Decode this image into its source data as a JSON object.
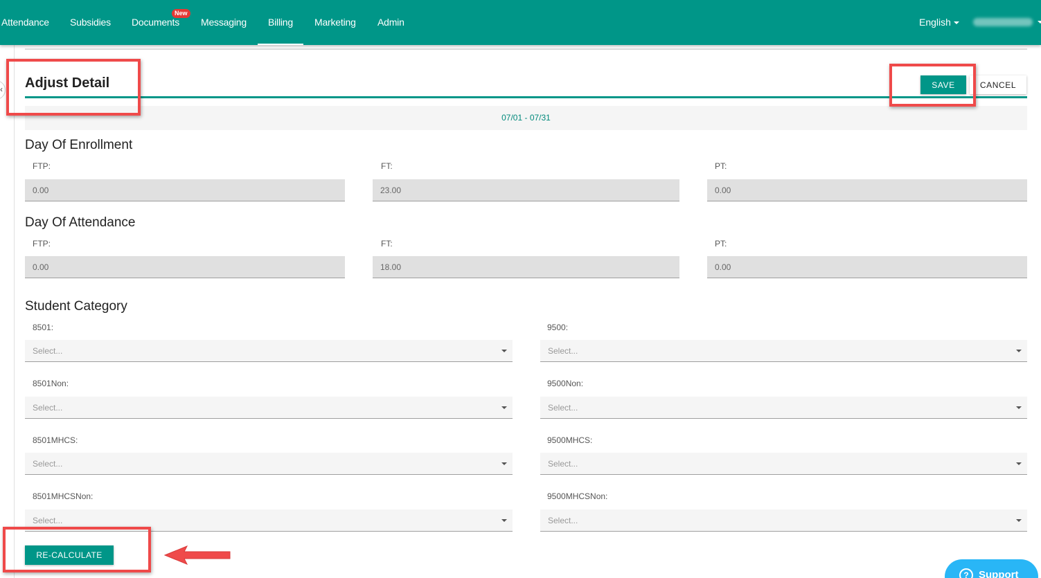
{
  "nav": {
    "items": [
      {
        "label": "Attendance",
        "active": false
      },
      {
        "label": "Subsidies",
        "active": false
      },
      {
        "label": "Documents",
        "active": false,
        "badge": "New"
      },
      {
        "label": "Messaging",
        "active": false
      },
      {
        "label": "Billing",
        "active": true
      },
      {
        "label": "Marketing",
        "active": false
      },
      {
        "label": "Admin",
        "active": false
      }
    ],
    "language": "English"
  },
  "header": {
    "title": "Adjust Detail",
    "save_label": "SAVE",
    "cancel_label": "CANCEL"
  },
  "period": "07/01 - 07/31",
  "enrollment": {
    "title": "Day Of Enrollment",
    "fields": [
      {
        "label": "FTP:",
        "value": "0.00"
      },
      {
        "label": "FT:",
        "value": "23.00"
      },
      {
        "label": "PT:",
        "value": "0.00"
      }
    ]
  },
  "attendance": {
    "title": "Day Of Attendance",
    "fields": [
      {
        "label": "FTP:",
        "value": "0.00"
      },
      {
        "label": "FT:",
        "value": "18.00"
      },
      {
        "label": "PT:",
        "value": "0.00"
      }
    ]
  },
  "category": {
    "title": "Student Category",
    "fields": [
      {
        "label": "8501:",
        "placeholder": "Select..."
      },
      {
        "label": "9500:",
        "placeholder": "Select..."
      },
      {
        "label": "8501Non:",
        "placeholder": "Select..."
      },
      {
        "label": "9500Non:",
        "placeholder": "Select..."
      },
      {
        "label": "8501MHCS:",
        "placeholder": "Select..."
      },
      {
        "label": "9500MHCS:",
        "placeholder": "Select..."
      },
      {
        "label": "8501MHCSNon:",
        "placeholder": "Select..."
      },
      {
        "label": "9500MHCSNon:",
        "placeholder": "Select..."
      }
    ]
  },
  "recalculate_label": "RE-CALCULATE",
  "support_label": "Support",
  "colors": {
    "primary": "#009688",
    "highlight": "#ef4a4a",
    "support": "#29b6f6",
    "badge": "#e53935"
  }
}
